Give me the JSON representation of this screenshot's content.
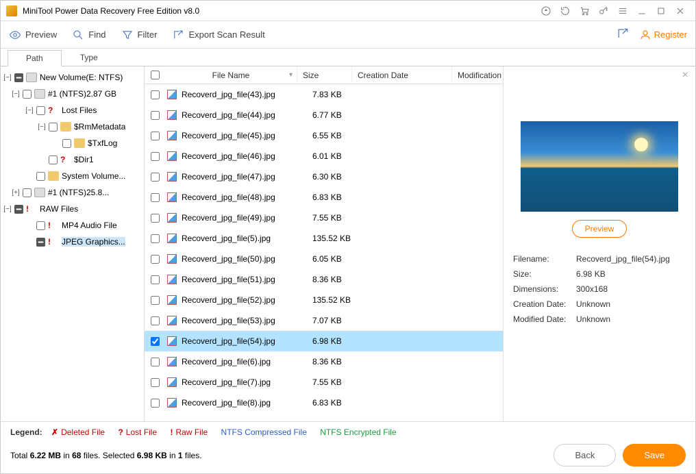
{
  "title": "MiniTool Power Data Recovery Free Edition v8.0",
  "toolbar": {
    "preview": "Preview",
    "find": "Find",
    "filter": "Filter",
    "export": "Export Scan Result",
    "register": "Register"
  },
  "tabs": {
    "path": "Path",
    "type": "Type"
  },
  "tree": [
    {
      "level": 1,
      "toggle": "-",
      "chk": "mixed",
      "icon": "disk",
      "label": "New Volume(E: NTFS)"
    },
    {
      "level": 2,
      "toggle": "-",
      "chk": "off",
      "icon": "disk",
      "label": "#1 (NTFS)2.87 GB"
    },
    {
      "level": 3,
      "toggle": "-",
      "chk": "off",
      "icon": "q",
      "label": "Lost Files"
    },
    {
      "level": 4,
      "toggle": "-",
      "chk": "off",
      "icon": "fold",
      "label": "$RmMetadata"
    },
    {
      "level": 5,
      "toggle": "",
      "chk": "off",
      "icon": "fold",
      "label": "$TxfLog"
    },
    {
      "level": 4,
      "toggle": "",
      "chk": "off",
      "icon": "q",
      "label": "$Dir1"
    },
    {
      "level": 3,
      "toggle": "",
      "chk": "off",
      "icon": "fold",
      "label": "System Volume..."
    },
    {
      "level": 2,
      "toggle": "+",
      "chk": "off",
      "icon": "disk",
      "label": "#1 (NTFS)25.8..."
    },
    {
      "level": 1,
      "toggle": "-",
      "chk": "mixed",
      "icon": "ex",
      "label": "RAW Files"
    },
    {
      "level": 3,
      "toggle": "",
      "chk": "off",
      "icon": "ex",
      "label": "MP4 Audio File"
    },
    {
      "level": 3,
      "toggle": "",
      "chk": "mixed",
      "icon": "ex",
      "label": "JPEG Graphics...",
      "sel": true
    }
  ],
  "columns": {
    "name": "File Name",
    "size": "Size",
    "cdate": "Creation Date",
    "mdate": "Modification"
  },
  "files": [
    {
      "name": "Recoverd_jpg_file(43).jpg",
      "size": "7.83 KB"
    },
    {
      "name": "Recoverd_jpg_file(44).jpg",
      "size": "6.77 KB"
    },
    {
      "name": "Recoverd_jpg_file(45).jpg",
      "size": "6.55 KB"
    },
    {
      "name": "Recoverd_jpg_file(46).jpg",
      "size": "6.01 KB"
    },
    {
      "name": "Recoverd_jpg_file(47).jpg",
      "size": "6.30 KB"
    },
    {
      "name": "Recoverd_jpg_file(48).jpg",
      "size": "6.83 KB"
    },
    {
      "name": "Recoverd_jpg_file(49).jpg",
      "size": "7.55 KB"
    },
    {
      "name": "Recoverd_jpg_file(5).jpg",
      "size": "135.52 KB"
    },
    {
      "name": "Recoverd_jpg_file(50).jpg",
      "size": "6.05 KB"
    },
    {
      "name": "Recoverd_jpg_file(51).jpg",
      "size": "8.36 KB"
    },
    {
      "name": "Recoverd_jpg_file(52).jpg",
      "size": "135.52 KB"
    },
    {
      "name": "Recoverd_jpg_file(53).jpg",
      "size": "7.07 KB"
    },
    {
      "name": "Recoverd_jpg_file(54).jpg",
      "size": "6.98 KB",
      "sel": true,
      "chk": true
    },
    {
      "name": "Recoverd_jpg_file(6).jpg",
      "size": "8.36 KB"
    },
    {
      "name": "Recoverd_jpg_file(7).jpg",
      "size": "7.55 KB"
    },
    {
      "name": "Recoverd_jpg_file(8).jpg",
      "size": "6.83 KB"
    }
  ],
  "preview": {
    "button": "Preview",
    "filename_k": "Filename:",
    "filename_v": "Recoverd_jpg_file(54).jpg",
    "size_k": "Size:",
    "size_v": "6.98 KB",
    "dim_k": "Dimensions:",
    "dim_v": "300x168",
    "cdate_k": "Creation Date:",
    "cdate_v": "Unknown",
    "mdate_k": "Modified Date:",
    "mdate_v": "Unknown"
  },
  "legend": {
    "title": "Legend:",
    "del": "Deleted File",
    "lost": "Lost File",
    "raw": "Raw File",
    "ntfsc": "NTFS Compressed File",
    "ntfse": "NTFS Encrypted File"
  },
  "status": {
    "t1": "Total ",
    "total_size": "6.22 MB",
    "t2": " in ",
    "total_files": "68",
    "t3": " files.  Selected ",
    "sel_size": "6.98 KB",
    "t4": " in ",
    "sel_files": "1",
    "t5": " files."
  },
  "buttons": {
    "back": "Back",
    "save": "Save"
  }
}
